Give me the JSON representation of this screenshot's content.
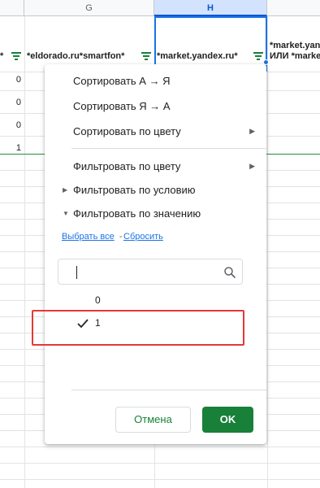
{
  "columns": {
    "g_letter": "G",
    "h_letter": "H"
  },
  "headers": {
    "col_left": "*",
    "col_g": "*eldorado.ru*smartfon*",
    "col_h": "*market.yandex.ru*",
    "col_i_line1": "*market.yand",
    "col_i_line2": "ИЛИ *marke"
  },
  "rows": {
    "values": [
      "0",
      "0",
      "0",
      "1"
    ]
  },
  "menu": {
    "sort_az": "Сортировать А → Я",
    "sort_za": "Сортировать Я → А",
    "sort_color": "Сортировать по цвету",
    "filter_color": "Фильтровать по цвету",
    "filter_condition": "Фильтровать по условию",
    "filter_value": "Фильтровать по значению",
    "select_all": "Выбрать все",
    "separator": "-",
    "reset": "Сбросить",
    "search_value": "",
    "value_items": [
      {
        "label": "0",
        "checked": false
      },
      {
        "label": "1",
        "checked": true
      }
    ],
    "cancel_label": "Отмена",
    "ok_label": "OK"
  },
  "colors": {
    "accent_green": "#188038",
    "selection_blue": "#1a73e8",
    "highlight_red": "#e53935"
  },
  "icons": {
    "filter": "filter-icon",
    "search": "search-icon",
    "submenu": "chevron-right-icon",
    "expand": "caret-right-icon",
    "collapse": "caret-down-icon",
    "check": "check-icon"
  }
}
